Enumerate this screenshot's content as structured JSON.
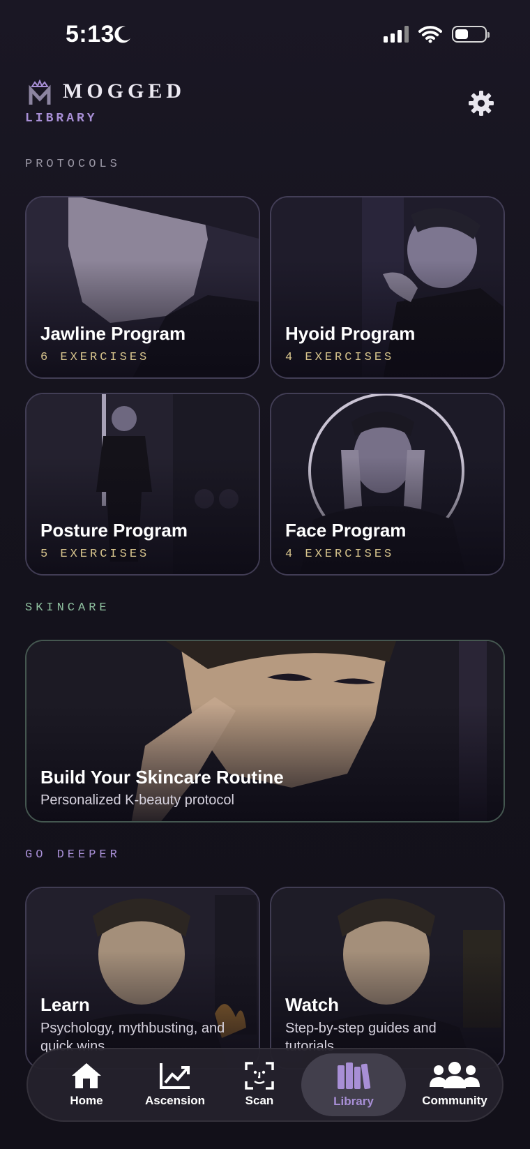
{
  "status_bar": {
    "time": "5:13"
  },
  "header": {
    "brand": "MOGGED",
    "page_title": "LIBRARY"
  },
  "sections": {
    "protocols": "PROTOCOLS",
    "skincare": "SKINCARE",
    "go_deeper": "GO DEEPER"
  },
  "protocols": [
    {
      "title": "Jawline Program",
      "subtitle": "6 EXERCISES"
    },
    {
      "title": "Hyoid Program",
      "subtitle": "4 EXERCISES"
    },
    {
      "title": "Posture Program",
      "subtitle": "5 EXERCISES"
    },
    {
      "title": "Face Program",
      "subtitle": "4 EXERCISES"
    }
  ],
  "skincare": {
    "title": "Build Your Skincare Routine",
    "subtitle": "Personalized K-beauty protocol"
  },
  "go_deeper": [
    {
      "title": "Learn",
      "subtitle": "Psychology, mythbusting, and quick wins"
    },
    {
      "title": "Watch",
      "subtitle": "Step-by-step guides and tutorials"
    }
  ],
  "nav": [
    {
      "label": "Home",
      "icon": "home-icon"
    },
    {
      "label": "Ascension",
      "icon": "trend-up-icon"
    },
    {
      "label": "Scan",
      "icon": "face-scan-icon"
    },
    {
      "label": "Library",
      "icon": "library-books-icon",
      "active": true
    },
    {
      "label": "Community",
      "icon": "people-icon"
    }
  ],
  "colors": {
    "accent": "#a88fd6",
    "exercise_count": "#d8c58d",
    "skincare_section": "#8fc0a0",
    "background": "#15131d"
  }
}
